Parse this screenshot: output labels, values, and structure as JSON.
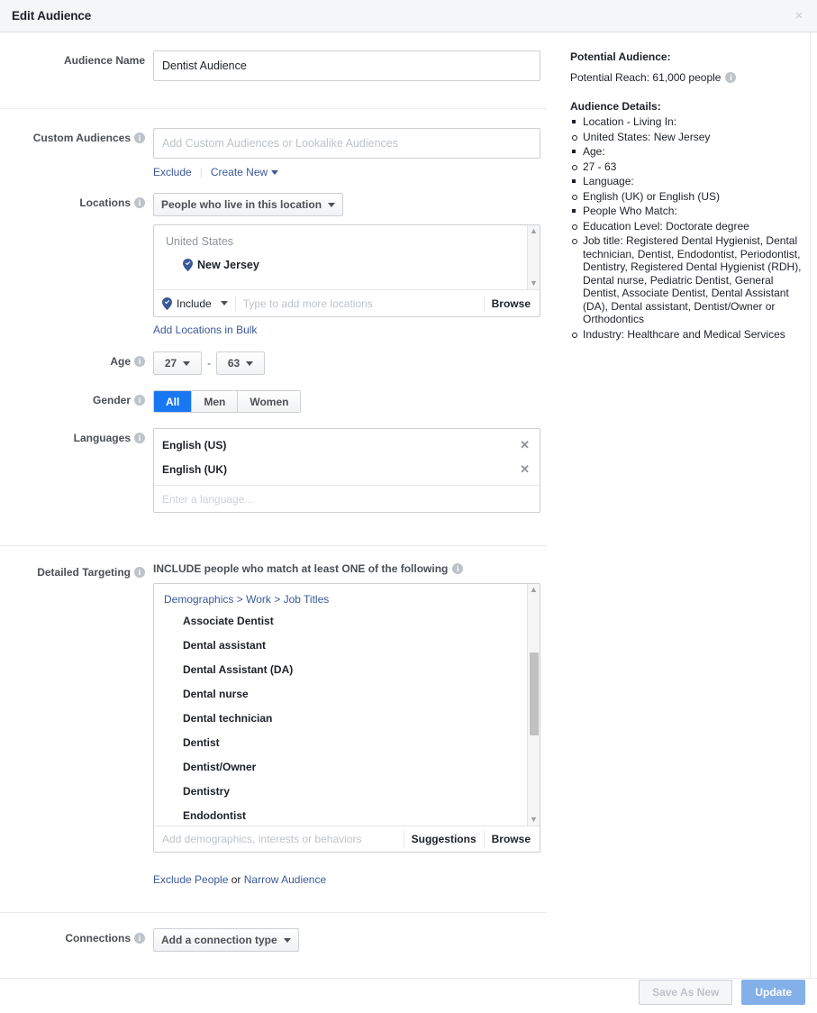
{
  "dialog": {
    "title": "Edit Audience",
    "close_label": "×"
  },
  "audience_name": {
    "label": "Audience Name",
    "value": "Dentist Audience"
  },
  "custom_audiences": {
    "label": "Custom Audiences",
    "placeholder": "Add Custom Audiences or Lookalike Audiences",
    "exclude_link": "Exclude",
    "create_new_link": "Create New"
  },
  "locations": {
    "label": "Locations",
    "type_dropdown": "People who live in this location",
    "country": "United States",
    "region": "New Jersey",
    "include_label": "Include",
    "input_placeholder": "Type to add more locations",
    "browse_label": "Browse",
    "bulk_link": "Add Locations in Bulk"
  },
  "age": {
    "label": "Age",
    "min": "27",
    "max": "63",
    "separator": "-"
  },
  "gender": {
    "label": "Gender",
    "options": [
      "All",
      "Men",
      "Women"
    ],
    "selected": "All"
  },
  "languages": {
    "label": "Languages",
    "items": [
      "English (US)",
      "English (UK)"
    ],
    "placeholder": "Enter a language...",
    "remove_label": "✕"
  },
  "detailed_targeting": {
    "label": "Detailed Targeting",
    "include_header": "INCLUDE people who match at least ONE of the following",
    "breadcrumb": [
      "Demographics",
      "Work",
      "Job Titles"
    ],
    "breadcrumb_sep": ">",
    "items": [
      "Associate Dentist",
      "Dental assistant",
      "Dental Assistant (DA)",
      "Dental nurse",
      "Dental technician",
      "Dentist",
      "Dentist/Owner",
      "Dentistry",
      "Endodontist"
    ],
    "input_placeholder": "Add demographics, interests or behaviors",
    "suggestions_label": "Suggestions",
    "browse_label": "Browse",
    "exclude_people_link": "Exclude People",
    "or_text": "or",
    "narrow_audience_link": "Narrow Audience"
  },
  "connections": {
    "label": "Connections",
    "dropdown": "Add a connection type"
  },
  "footer": {
    "save_as_new": "Save As New",
    "update": "Update"
  },
  "right_panel": {
    "potential_audience_title": "Potential Audience:",
    "potential_reach": "Potential Reach: 61,000 people",
    "audience_details_title": "Audience Details:",
    "details": [
      {
        "marker": "square",
        "text": "Location - Living In:"
      },
      {
        "marker": "circle",
        "text": "United States: New Jersey"
      },
      {
        "marker": "square",
        "text": "Age:"
      },
      {
        "marker": "circle",
        "text": "27 - 63"
      },
      {
        "marker": "square",
        "text": "Language:"
      },
      {
        "marker": "circle",
        "text": "English (UK) or English (US)"
      },
      {
        "marker": "square",
        "text": "People Who Match:"
      },
      {
        "marker": "circle",
        "text": "Education Level: Doctorate degree"
      },
      {
        "marker": "circle",
        "text": "Job title: Registered Dental Hygienist, Dental technician, Dentist, Endodontist, Periodontist, Dentistry, Registered Dental Hygienist (RDH), Dental nurse, Pediatric Dentist, General Dentist, Associate Dentist, Dental Assistant (DA), Dental assistant, Dentist/Owner or Orthodontics"
      },
      {
        "marker": "circle",
        "text": "Industry: Healthcare and Medical Services"
      }
    ]
  },
  "colors": {
    "accent_blue": "#1877f2",
    "link_blue": "#3b5998",
    "primary_button": "#83b0e8",
    "header_bg": "#f5f6f7",
    "border": "#ccd0d5"
  }
}
